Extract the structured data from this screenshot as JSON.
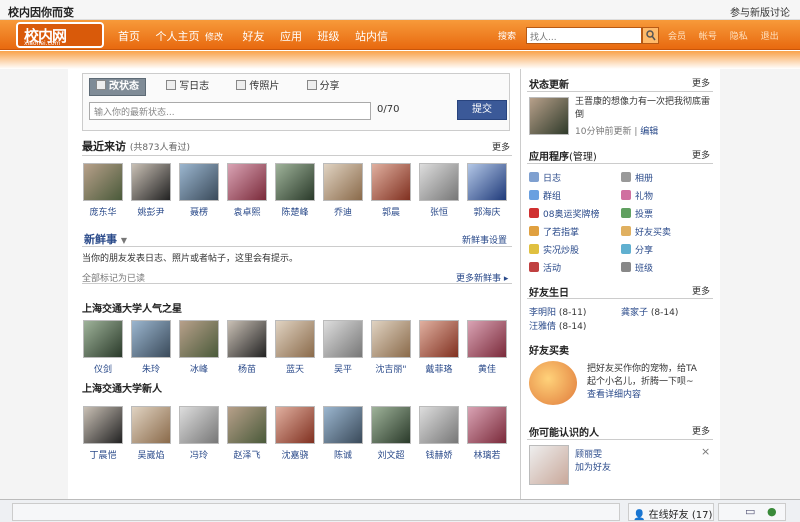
{
  "topstrip": {
    "title": "校内因你而变",
    "link": "参与新版讨论"
  },
  "header": {
    "logo_text": "校内网",
    "logo_sub": "xiaonei.com",
    "nav": [
      "首页",
      "个人主页",
      "修改",
      "好友",
      "应用",
      "班级",
      "站内信"
    ],
    "search_label": "搜索",
    "search_placeholder": "找人...",
    "right_links": [
      "会员",
      "帐号",
      "隐私",
      "退出"
    ]
  },
  "status": {
    "tabs": [
      "改状态",
      "写日志",
      "传照片",
      "分享"
    ],
    "placeholder": "输入你的最新状态...",
    "count": "0/70",
    "submit": "提交"
  },
  "visitors": {
    "title": "最近来访",
    "count_text": "(共873人看过)",
    "more": "更多",
    "people": [
      "庞东华",
      "姚彭尹",
      "聂楞",
      "袁卓熙",
      "陈楚峰",
      "乔迪",
      "郭晨",
      "张恒",
      "郭海庆"
    ]
  },
  "news": {
    "title": "新鲜事",
    "settings": "新鲜事设置",
    "desc": "当你的朋友发表日志、照片或者帖子，这里会有提示。",
    "mark_read": "全部标记为已读",
    "more": "更多新鲜事"
  },
  "stars": {
    "title": "上海交通大学人气之星",
    "people": [
      "仪剑",
      "朱玲",
      "冰峰",
      "杨苗",
      "蓝天",
      "吴平",
      "沈吉丽\"",
      "戴菲珞",
      "黄佳"
    ]
  },
  "newbies": {
    "title": "上海交通大学新人",
    "people": [
      "丁晨恺",
      "吴崴焰",
      "冯玲",
      "赵泽飞",
      "沈嘉骁",
      "陈诚",
      "刘文超",
      "钱赫娇",
      "林璃若"
    ]
  },
  "side": {
    "status_update": {
      "title": "状态更新",
      "more": "更多",
      "text": "王晋康的想像力有一次把我彻底雷倒",
      "time": "10分钟前更新",
      "edit": "编辑"
    },
    "apps": {
      "title": "应用程序",
      "manage": "(管理)",
      "more": "更多",
      "left": [
        "日志",
        "群组",
        "08奥运奖牌榜",
        "了若指掌",
        "实况炒股",
        "活动"
      ],
      "right": [
        "相册",
        "礼物",
        "投票",
        "好友买卖",
        "分享",
        "班级"
      ]
    },
    "birthday": {
      "title": "好友生日",
      "more": "更多",
      "items": [
        {
          "name": "李明阳",
          "date": "(8-11)"
        },
        {
          "name": "龚家子",
          "date": "(8-14)"
        },
        {
          "name": "汪雅倩",
          "date": "(8-14)"
        }
      ]
    },
    "buy": {
      "title": "好友买卖",
      "text1": "把好友买作你的宠物，给TA",
      "text2": "起个小名儿，折腾一下呗~",
      "link": "查看详细内容"
    },
    "pymk": {
      "title": "你可能认识的人",
      "more": "更多",
      "name": "顾丽雯",
      "action": "加为好友",
      "close": "×"
    }
  },
  "bottom": {
    "online": "在线好友",
    "online_count": "(17)"
  }
}
